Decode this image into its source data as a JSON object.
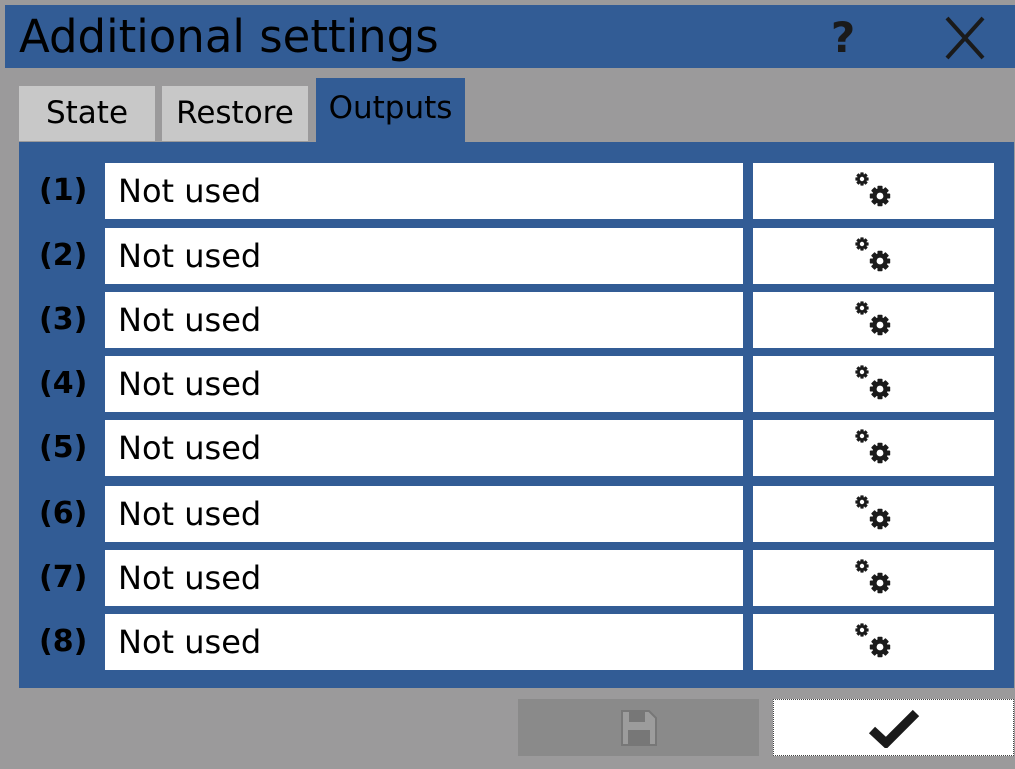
{
  "dialog": {
    "title": "Additional settings",
    "help_label": "?"
  },
  "tabs": [
    {
      "label": "State",
      "active": false
    },
    {
      "label": "Restore",
      "active": false
    },
    {
      "label": "Outputs",
      "active": true
    }
  ],
  "outputs": [
    {
      "number": "(1)",
      "value": "Not used",
      "icon": "gears-icon"
    },
    {
      "number": "(2)",
      "value": "Not used",
      "icon": "gears-icon"
    },
    {
      "number": "(3)",
      "value": "Not used",
      "icon": "gears-icon"
    },
    {
      "number": "(4)",
      "value": "Not used",
      "icon": "gears-icon"
    },
    {
      "number": "(5)",
      "value": "Not used",
      "icon": "gears-icon"
    },
    {
      "number": "(6)",
      "value": "Not used",
      "icon": "gears-icon"
    },
    {
      "number": "(7)",
      "value": "Not used",
      "icon": "gears-icon"
    },
    {
      "number": "(8)",
      "value": "Not used",
      "icon": "gears-icon"
    }
  ],
  "footer": {
    "save_icon": "save-icon",
    "save_enabled": false,
    "confirm_icon": "checkmark-icon"
  },
  "colors": {
    "accent": "#325c95",
    "background": "#9b9a9b",
    "tab_inactive": "#c8c8c8",
    "disabled_button": "#8a8a8a"
  }
}
